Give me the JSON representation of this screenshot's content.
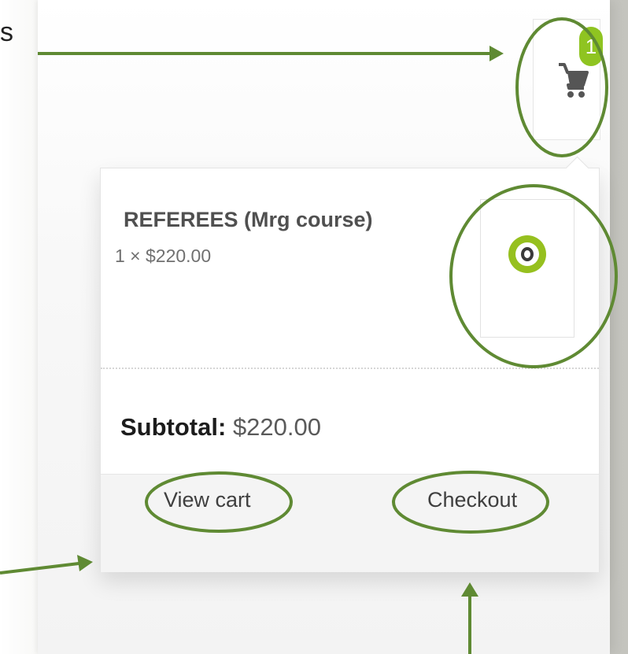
{
  "page": {
    "edge_letter": "s"
  },
  "cart": {
    "icon": "shopping-cart-icon",
    "badge_count": "1"
  },
  "item": {
    "name": "REFEREES (Mrg course)",
    "quantity_price": "1 × $220.00",
    "thumbnail_icon": "brand-logo-icon"
  },
  "summary": {
    "subtotal_label": "Subtotal:",
    "subtotal_value": "$220.00"
  },
  "actions": {
    "view_cart_label": "View cart",
    "checkout_label": "Checkout"
  },
  "colors": {
    "annotation": "#5f8a33",
    "badge": "#8fc421",
    "logo": "#96c01f"
  }
}
